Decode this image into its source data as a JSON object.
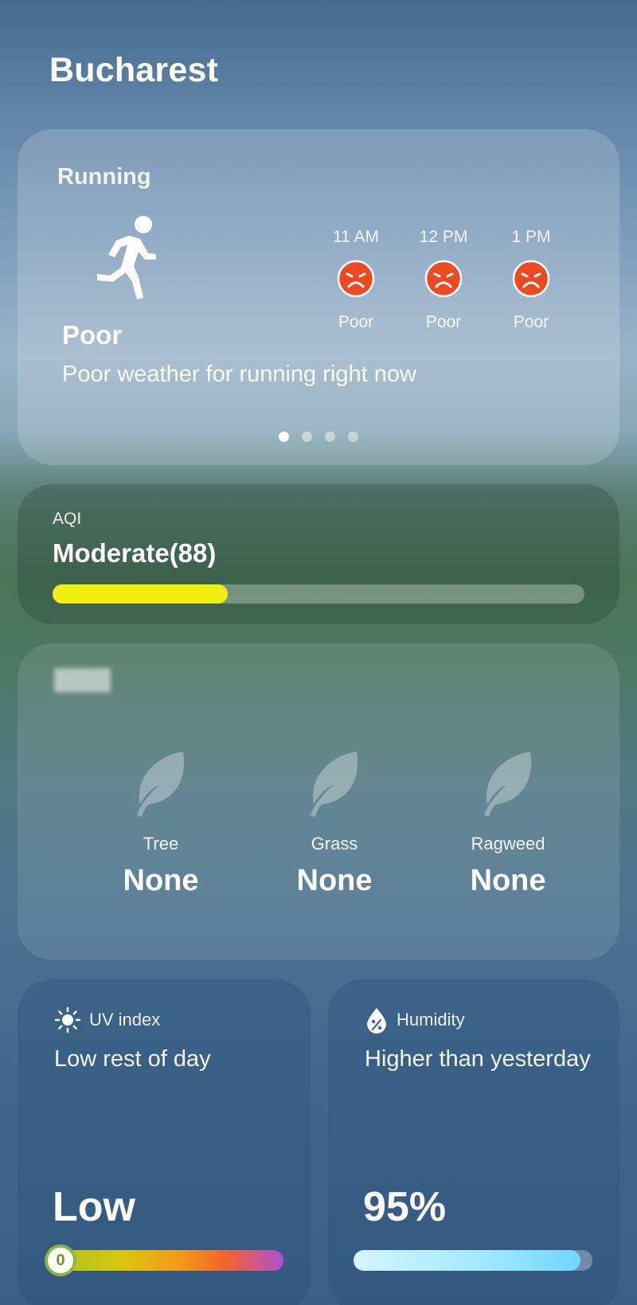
{
  "city": "Bucharest",
  "running": {
    "label": "Running",
    "rating": "Poor",
    "description": "Poor weather for running right now",
    "icon": "running-person-icon",
    "forecast": [
      {
        "time": "11 AM",
        "status": "Poor",
        "icon": "sad-face-icon"
      },
      {
        "time": "12 PM",
        "status": "Poor",
        "icon": "sad-face-icon"
      },
      {
        "time": "1 PM",
        "status": "Poor",
        "icon": "sad-face-icon"
      }
    ],
    "pages": 4,
    "active_page": 1,
    "status_color": "#ee4a22"
  },
  "aqi": {
    "label": "AQI",
    "value": "Moderate(88)",
    "level_fraction": 0.33,
    "bar_color": "#f2ef13"
  },
  "pollen": {
    "items": [
      {
        "name": "Tree",
        "level": "None",
        "icon": "leaf-icon"
      },
      {
        "name": "Grass",
        "level": "None",
        "icon": "leaf-icon"
      },
      {
        "name": "Ragweed",
        "level": "None",
        "icon": "leaf-icon"
      }
    ]
  },
  "uv": {
    "title": "UV index",
    "description": "Low rest of day",
    "value": "Low",
    "index": "0",
    "icon": "sun-icon"
  },
  "humidity": {
    "title": "Humidity",
    "description": "Higher than yesterday",
    "value": "95%",
    "percent": 95,
    "icon": "water-drop-icon"
  }
}
